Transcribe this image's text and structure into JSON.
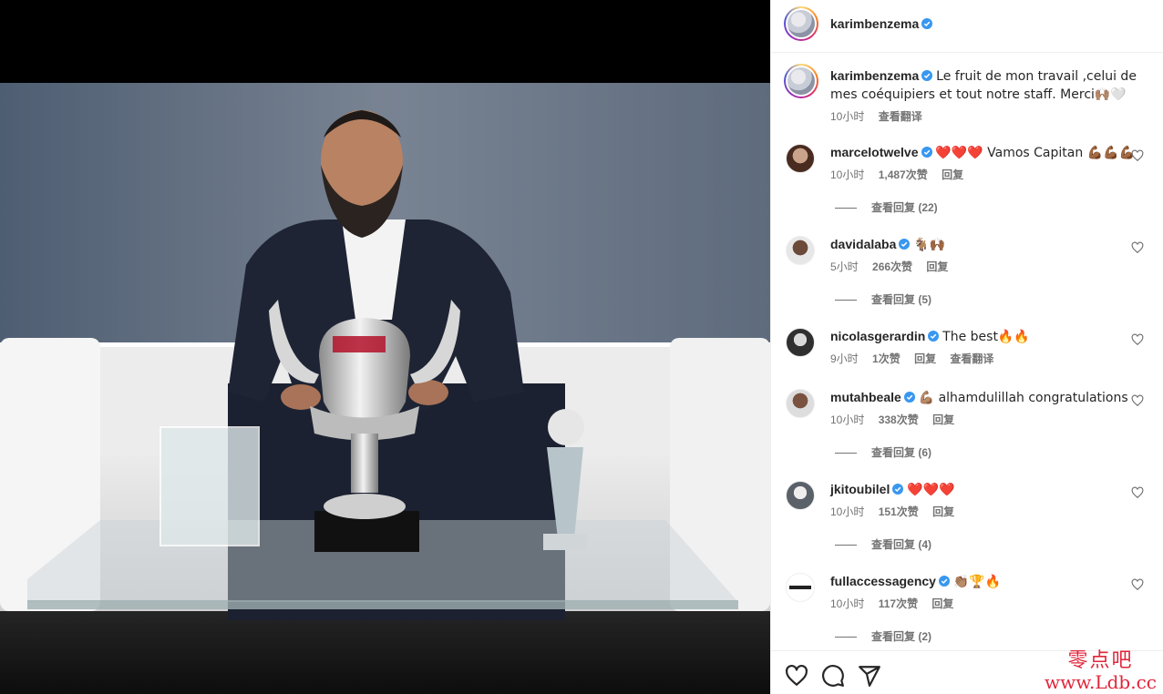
{
  "post": {
    "author": "karimbenzema",
    "caption": "Le fruit de mon travail ,celui de mes coéquipiers et tout notre staff. Merci🙌🏽🤍",
    "time": "10小时",
    "translate": "查看翻译"
  },
  "comments": [
    {
      "user": "marcelotwelve",
      "verified": true,
      "text": "❤️❤️❤️ Vamos Capitan 💪🏾💪🏾💪🏾",
      "time": "10小时",
      "likes": "1,487次赞",
      "reply": "回复",
      "view_replies": "查看回复 (22)"
    },
    {
      "user": "davidalaba",
      "verified": true,
      "text": "🐐🙌🏾",
      "time": "5小时",
      "likes": "266次赞",
      "reply": "回复",
      "view_replies": "查看回复 (5)"
    },
    {
      "user": "nicolasgerardin",
      "verified": true,
      "text": "The best🔥🔥",
      "time": "9小时",
      "likes": "1次赞",
      "reply": "回复",
      "translate": "查看翻译"
    },
    {
      "user": "mutahbeale",
      "verified": true,
      "text": "💪🏽 alhamdulillah congratulations",
      "time": "10小时",
      "likes": "338次赞",
      "reply": "回复",
      "view_replies": "查看回复 (6)"
    },
    {
      "user": "jkitoubilel",
      "verified": true,
      "text": "❤️❤️❤️",
      "time": "10小时",
      "likes": "151次赞",
      "reply": "回复",
      "view_replies": "查看回复 (4)"
    },
    {
      "user": "fullaccessagency",
      "verified": true,
      "text": "👏🏽🏆🔥",
      "time": "10小时",
      "likes": "117次赞",
      "reply": "回复",
      "view_replies": "查看回复 (2)"
    }
  ],
  "watermark": {
    "line1": "零点吧",
    "line2": "www.Ldb.cc"
  },
  "colors": {
    "verified": "#3897f0",
    "muted": "#737373",
    "text": "#262626"
  }
}
